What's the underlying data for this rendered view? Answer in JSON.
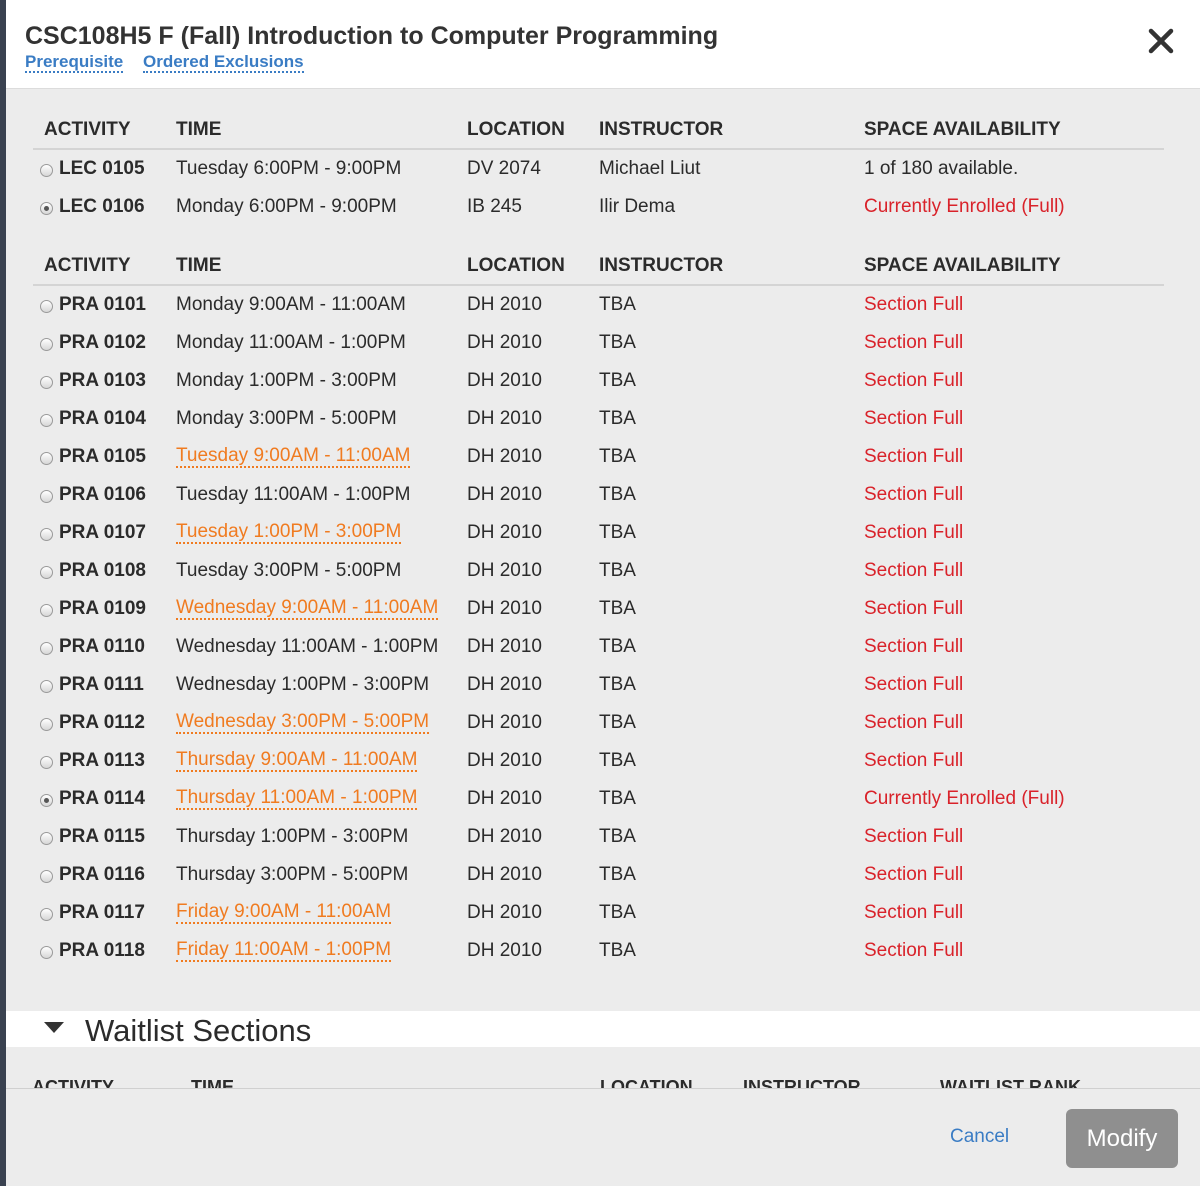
{
  "modal": {
    "title": "CSC108H5 F (Fall) Introduction to Computer Programming",
    "links": {
      "prerequisite": "Prerequisite",
      "exclusions": "Ordered Exclusions"
    }
  },
  "columns": {
    "activity": "ACTIVITY",
    "time": "TIME",
    "location": "LOCATION",
    "instructor": "INSTRUCTOR",
    "space": "SPACE AVAILABILITY"
  },
  "lectures": [
    {
      "activity": "LEC 0105",
      "time": "Tuesday 6:00PM - 9:00PM",
      "location": "DV 2074",
      "instructor": "Michael Liut",
      "space": "1 of 180 available.",
      "selected": false,
      "conflict": false,
      "full": false
    },
    {
      "activity": "LEC 0106",
      "time": "Monday 6:00PM - 9:00PM",
      "location": "IB 245",
      "instructor": "Ilir Dema",
      "space": "Currently Enrolled (Full)",
      "selected": true,
      "conflict": false,
      "full": true
    }
  ],
  "practicals": [
    {
      "activity": "PRA 0101",
      "time": "Monday 9:00AM - 11:00AM",
      "location": "DH 2010",
      "instructor": "TBA",
      "space": "Section Full",
      "selected": false,
      "conflict": false
    },
    {
      "activity": "PRA 0102",
      "time": "Monday 11:00AM - 1:00PM",
      "location": "DH 2010",
      "instructor": "TBA",
      "space": "Section Full",
      "selected": false,
      "conflict": false
    },
    {
      "activity": "PRA 0103",
      "time": "Monday 1:00PM - 3:00PM",
      "location": "DH 2010",
      "instructor": "TBA",
      "space": "Section Full",
      "selected": false,
      "conflict": false
    },
    {
      "activity": "PRA 0104",
      "time": "Monday 3:00PM - 5:00PM",
      "location": "DH 2010",
      "instructor": "TBA",
      "space": "Section Full",
      "selected": false,
      "conflict": false
    },
    {
      "activity": "PRA 0105",
      "time": "Tuesday 9:00AM - 11:00AM",
      "location": "DH 2010",
      "instructor": "TBA",
      "space": "Section Full",
      "selected": false,
      "conflict": true
    },
    {
      "activity": "PRA 0106",
      "time": "Tuesday 11:00AM - 1:00PM",
      "location": "DH 2010",
      "instructor": "TBA",
      "space": "Section Full",
      "selected": false,
      "conflict": false
    },
    {
      "activity": "PRA 0107",
      "time": "Tuesday 1:00PM - 3:00PM",
      "location": "DH 2010",
      "instructor": "TBA",
      "space": "Section Full",
      "selected": false,
      "conflict": true
    },
    {
      "activity": "PRA 0108",
      "time": "Tuesday 3:00PM - 5:00PM",
      "location": "DH 2010",
      "instructor": "TBA",
      "space": "Section Full",
      "selected": false,
      "conflict": false
    },
    {
      "activity": "PRA 0109",
      "time": "Wednesday 9:00AM - 11:00AM",
      "location": "DH 2010",
      "instructor": "TBA",
      "space": "Section Full",
      "selected": false,
      "conflict": true
    },
    {
      "activity": "PRA 0110",
      "time": "Wednesday 11:00AM - 1:00PM",
      "location": "DH 2010",
      "instructor": "TBA",
      "space": "Section Full",
      "selected": false,
      "conflict": false
    },
    {
      "activity": "PRA 0111",
      "time": "Wednesday 1:00PM - 3:00PM",
      "location": "DH 2010",
      "instructor": "TBA",
      "space": "Section Full",
      "selected": false,
      "conflict": false
    },
    {
      "activity": "PRA 0112",
      "time": "Wednesday 3:00PM - 5:00PM",
      "location": "DH 2010",
      "instructor": "TBA",
      "space": "Section Full",
      "selected": false,
      "conflict": true
    },
    {
      "activity": "PRA 0113",
      "time": "Thursday 9:00AM - 11:00AM",
      "location": "DH 2010",
      "instructor": "TBA",
      "space": "Section Full",
      "selected": false,
      "conflict": true
    },
    {
      "activity": "PRA 0114",
      "time": "Thursday 11:00AM - 1:00PM",
      "location": "DH 2010",
      "instructor": "TBA",
      "space": "Currently Enrolled (Full)",
      "selected": true,
      "conflict": true
    },
    {
      "activity": "PRA 0115",
      "time": "Thursday 1:00PM - 3:00PM",
      "location": "DH 2010",
      "instructor": "TBA",
      "space": "Section Full",
      "selected": false,
      "conflict": false
    },
    {
      "activity": "PRA 0116",
      "time": "Thursday 3:00PM - 5:00PM",
      "location": "DH 2010",
      "instructor": "TBA",
      "space": "Section Full",
      "selected": false,
      "conflict": false
    },
    {
      "activity": "PRA 0117",
      "time": "Friday 9:00AM - 11:00AM",
      "location": "DH 2010",
      "instructor": "TBA",
      "space": "Section Full",
      "selected": false,
      "conflict": true
    },
    {
      "activity": "PRA 0118",
      "time": "Friday 11:00AM - 1:00PM",
      "location": "DH 2010",
      "instructor": "TBA",
      "space": "Section Full",
      "selected": false,
      "conflict": true
    }
  ],
  "waitlist": {
    "title": "Waitlist Sections",
    "columns": {
      "activity": "ACTIVITY",
      "time": "TIME",
      "location": "LOCATION",
      "instructor": "INSTRUCTOR",
      "rank": "WAITLIST RANK"
    }
  },
  "footer": {
    "cancel": "Cancel",
    "modify": "Modify"
  },
  "colors": {
    "conflict": "#f07b20",
    "full": "#d9222a",
    "link": "#3a7cc4"
  }
}
